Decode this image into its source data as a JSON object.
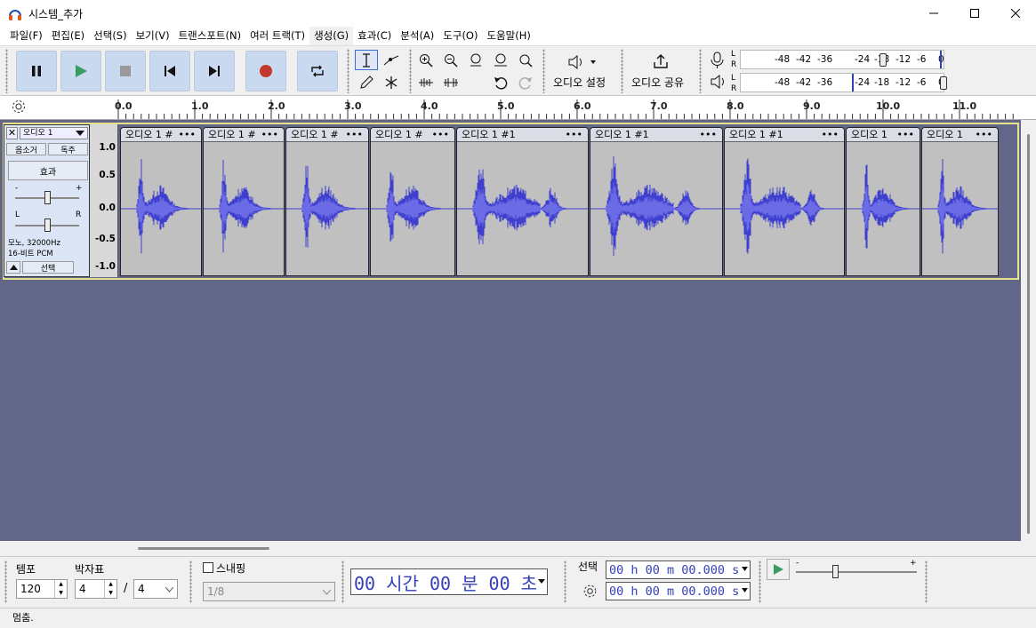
{
  "window": {
    "title": "시스템_추가"
  },
  "menu": [
    "파일(F)",
    "편집(E)",
    "선택(S)",
    "보기(V)",
    "트랜스포트(N)",
    "여러 트랙(T)",
    "생성(G)",
    "효과(C)",
    "분석(A)",
    "도구(O)",
    "도움말(H)"
  ],
  "toolbar": {
    "audio_setup_label": "오디오 설정",
    "share_audio_label": "오디오 공유",
    "rec_meter": {
      "L": "L",
      "R": "R",
      "scale": [
        "-48",
        "-42",
        "-36",
        "-24",
        "-18",
        "-12",
        "-6",
        "0"
      ]
    },
    "play_meter": {
      "L": "L",
      "R": "R",
      "scale": [
        "-48",
        "-42",
        "-36",
        "-24",
        "-18",
        "-12",
        "-6",
        "0"
      ]
    }
  },
  "ruler": {
    "ticks": [
      "0.0",
      "1.0",
      "2.0",
      "3.0",
      "4.0",
      "5.0",
      "6.0",
      "7.0",
      "8.0",
      "9.0",
      "10.0",
      "11.0"
    ]
  },
  "track": {
    "name": "오디오 1",
    "mute": "음소거",
    "solo": "독주",
    "effects": "효과",
    "gain_minus": "-",
    "gain_plus": "+",
    "pan_left": "L",
    "pan_right": "R",
    "info_line1": "모노, 32000Hz",
    "info_line2": "16-비트 PCM",
    "select": "선택",
    "scale": [
      "1.0",
      "0.5",
      "0.0",
      "-0.5",
      "-1.0"
    ]
  },
  "clips": [
    {
      "label": "오디오 1 #",
      "menu": "•••"
    },
    {
      "label": "오디오 1 #",
      "menu": "•••"
    },
    {
      "label": "오디오 1 #",
      "menu": "•••"
    },
    {
      "label": "오디오 1 #",
      "menu": "•••"
    },
    {
      "label": "오디오 1 #1",
      "menu": "•••"
    },
    {
      "label": "오디오 1 #1",
      "menu": "•••"
    },
    {
      "label": "오디오 1 #1",
      "menu": "•••"
    },
    {
      "label": "오디오 1",
      "menu": "•••"
    },
    {
      "label": "오디오 1",
      "menu": "•••"
    }
  ],
  "bottom": {
    "tempo_label": "템포",
    "tempo_value": "120",
    "timesig_label": "박자표",
    "timesig_num": "4",
    "timesig_slash": "/",
    "timesig_den": "4",
    "snap_label": "스내핑",
    "snap_value": "1/8",
    "time_display": "00 시간 00 분 00 초",
    "selection_label": "선택",
    "sel_start": "00 h 00 m 00.000 s",
    "sel_end": "00 h 00 m 00.000 s",
    "speed_minus": "-",
    "speed_plus": "+"
  },
  "status": "멈춤.",
  "colors": {
    "waveform": "#3f3fcf",
    "track_bg": "#626789",
    "clip_bg": "#c0c0c0",
    "button": "#c9d9ef",
    "record": "#c0392b",
    "play": "#3a9a60"
  }
}
